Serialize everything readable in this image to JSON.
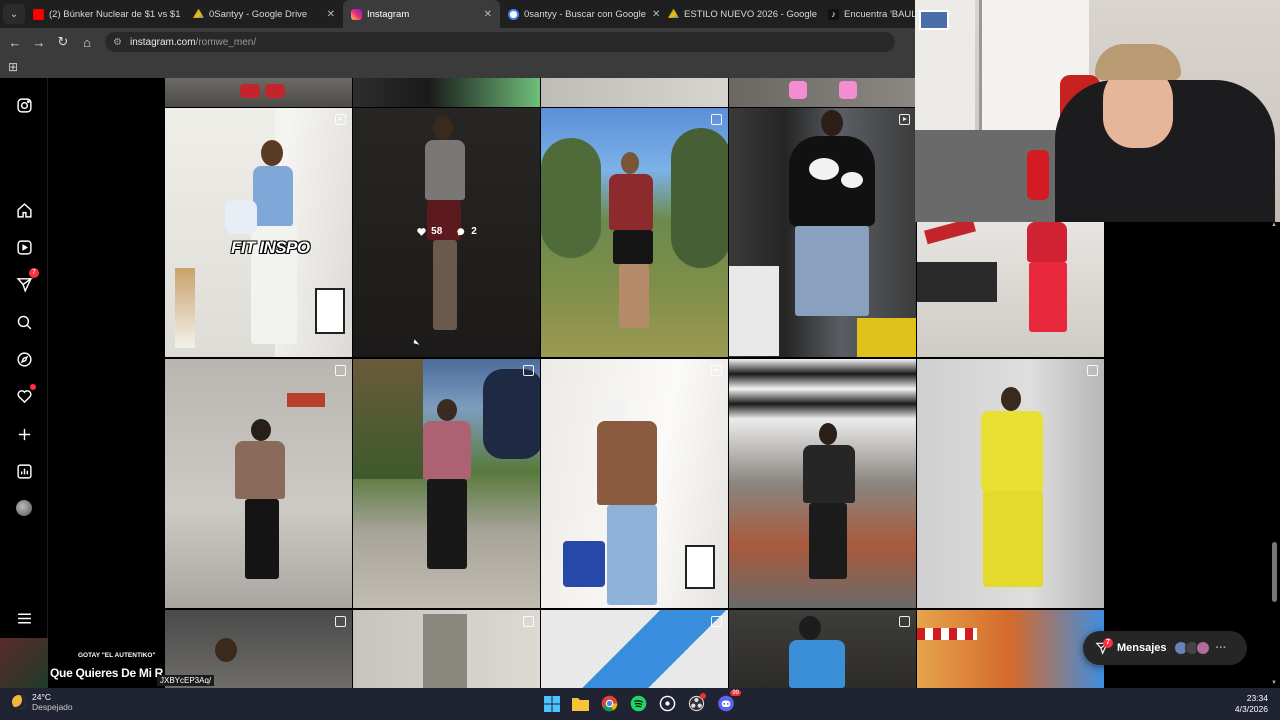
{
  "browser": {
    "tabs": [
      {
        "title": "(2) Búnker Nuclear de $1 vs $1",
        "icon": "youtube-icon",
        "color": "#ff0000"
      },
      {
        "title": "0Santyy - Google Drive",
        "icon": "google-drive-icon",
        "color": "#34a853"
      },
      {
        "title": "Instagram",
        "icon": "instagram-icon",
        "color": "#e1306c",
        "active": true
      },
      {
        "title": "0santyy - Buscar con Google",
        "icon": "google-icon",
        "color": "#4285f4"
      },
      {
        "title": "ESTILO NUEVO 2026 - Google",
        "icon": "google-drive-icon",
        "color": "#fbbc05"
      },
      {
        "title": "Encuentra 'BAULETTI",
        "icon": "tiktok-icon",
        "color": "#ffffff"
      }
    ],
    "url_host": "instagram.com",
    "url_path": "/romwe_men/"
  },
  "instagram": {
    "post_overlay_text": "FIT INSPO",
    "hover_stats": {
      "likes": "58",
      "comments": "2"
    },
    "notifications_badge": "7"
  },
  "messages": {
    "label": "Mensajes",
    "badge": "7"
  },
  "stream": {
    "artist": "GOTAY \"EL AUTENTIKO\"",
    "song": "Que Quieres De Mi R",
    "url": "JXBYcEP3Aq/"
  },
  "taskbar": {
    "temperature": "24°C",
    "condition": "Despejado",
    "time": "23:34",
    "date": "4/3/2026",
    "discord_badge": "99"
  }
}
